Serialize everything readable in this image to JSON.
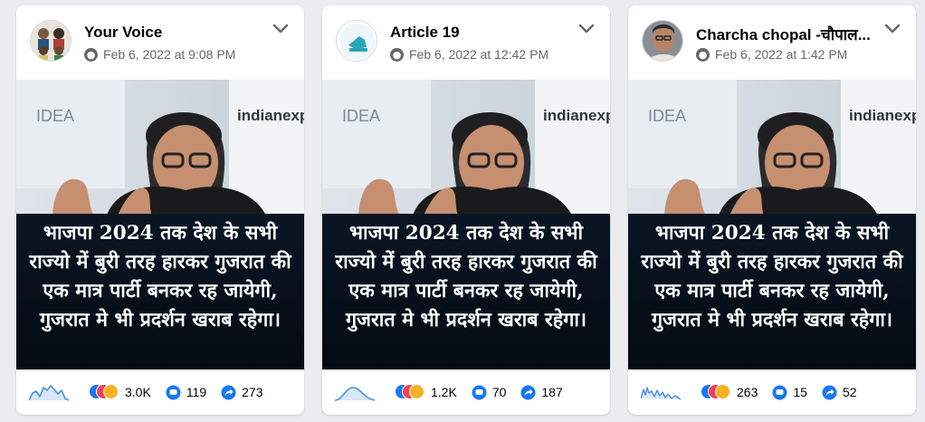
{
  "posts": [
    {
      "page_name": "Your Voice",
      "timestamp": "Feb 6, 2022 at 9:08 PM",
      "image_text": "भाजपा 2024 तक देश के सभी राज्यो में बुरी तरह हारकर गुजरात की एक मात्र पार्टी बनकर रह जायेगी, गुजरात मे भी प्रदर्शन खराब रहेगा।",
      "image_watermark": "indianexp",
      "image_sign": "IDEA",
      "reactions": "3.0K",
      "comments": "119",
      "shares": "273"
    },
    {
      "page_name": "Article 19",
      "timestamp": "Feb 6, 2022 at 12:42 PM",
      "image_text": "भाजपा 2024 तक देश के सभी राज्यो में बुरी तरह हारकर गुजरात की एक मात्र पार्टी बनकर रह जायेगी, गुजरात मे भी प्रदर्शन खराब रहेगा।",
      "image_watermark": "indianexp",
      "image_sign": "IDEA",
      "reactions": "1.2K",
      "comments": "70",
      "shares": "187"
    },
    {
      "page_name": "Charcha chopal -चौपाल...",
      "timestamp": "Feb 6, 2022 at 1:42 PM",
      "image_text": "भाजपा 2024 तक देश के सभी राज्यो में बुरी तरह हारकर गुजरात की एक मात्र पार्टी बनकर रह जायेगी, गुजरात मे भी प्रदर्शन खराब रहेगा।",
      "image_watermark": "indianexp",
      "image_sign": "IDEA",
      "reactions": "263",
      "comments": "15",
      "shares": "52"
    }
  ],
  "icons": {
    "globe": "globe-icon",
    "menu": "chevron-down-icon",
    "reactions": "reaction-icons",
    "comment": "comment-icon",
    "share": "share-icon",
    "sparkline": "sparkline-icon"
  },
  "colors": {
    "facebook_blue": "#1877f2",
    "secondary_text": "#65676b",
    "overlay_bg": "#0a1524"
  }
}
